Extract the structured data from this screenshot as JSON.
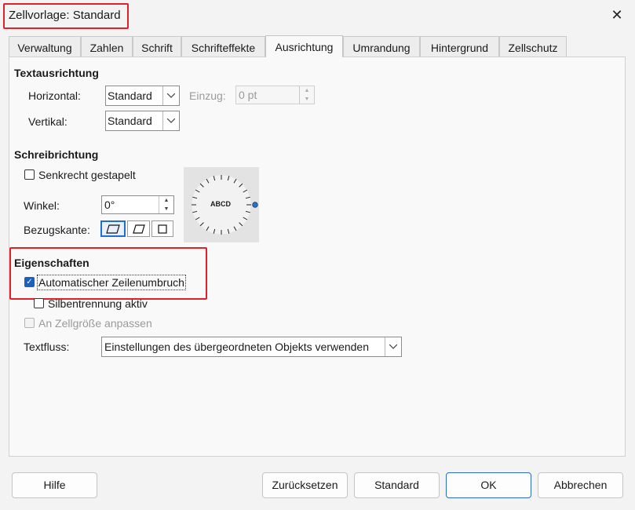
{
  "window": {
    "title": "Zellvorlage: Standard",
    "close_icon": "close-icon"
  },
  "tabs": [
    {
      "label": "Verwaltung"
    },
    {
      "label": "Zahlen"
    },
    {
      "label": "Schrift"
    },
    {
      "label": "Schrifteffekte"
    },
    {
      "label": "Ausrichtung",
      "active": true
    },
    {
      "label": "Umrandung"
    },
    {
      "label": "Hintergrund"
    },
    {
      "label": "Zellschutz"
    }
  ],
  "textausrichtung": {
    "heading": "Textausrichtung",
    "horizontal_label": "Horizontal:",
    "horizontal_value": "Standard",
    "einzug_label": "Einzug:",
    "einzug_value": "0 pt",
    "vertikal_label": "Vertikal:",
    "vertikal_value": "Standard"
  },
  "schreibrichtung": {
    "heading": "Schreibrichtung",
    "senkrecht_label": "Senkrecht gestapelt",
    "winkel_label": "Winkel:",
    "winkel_value": "0°",
    "bezugskante_label": "Bezugskante:",
    "dial_text": "ABCD"
  },
  "eigenschaften": {
    "heading": "Eigenschaften",
    "zeilenumbruch_label": "Automatischer Zeilenumbruch",
    "silben_label": "Silbentrennung aktiv",
    "zellgroesse_label": "An Zellgröße anpassen",
    "textfluss_label": "Textfluss:",
    "textfluss_value": "Einstellungen des übergeordneten Objekts verwenden"
  },
  "buttons": {
    "hilfe": "Hilfe",
    "zuruecksetzen": "Zurücksetzen",
    "standard": "Standard",
    "ok": "OK",
    "abbrechen": "Abbrechen"
  },
  "colors": {
    "highlight": "#e0202a",
    "accent": "#1d5fbd"
  }
}
